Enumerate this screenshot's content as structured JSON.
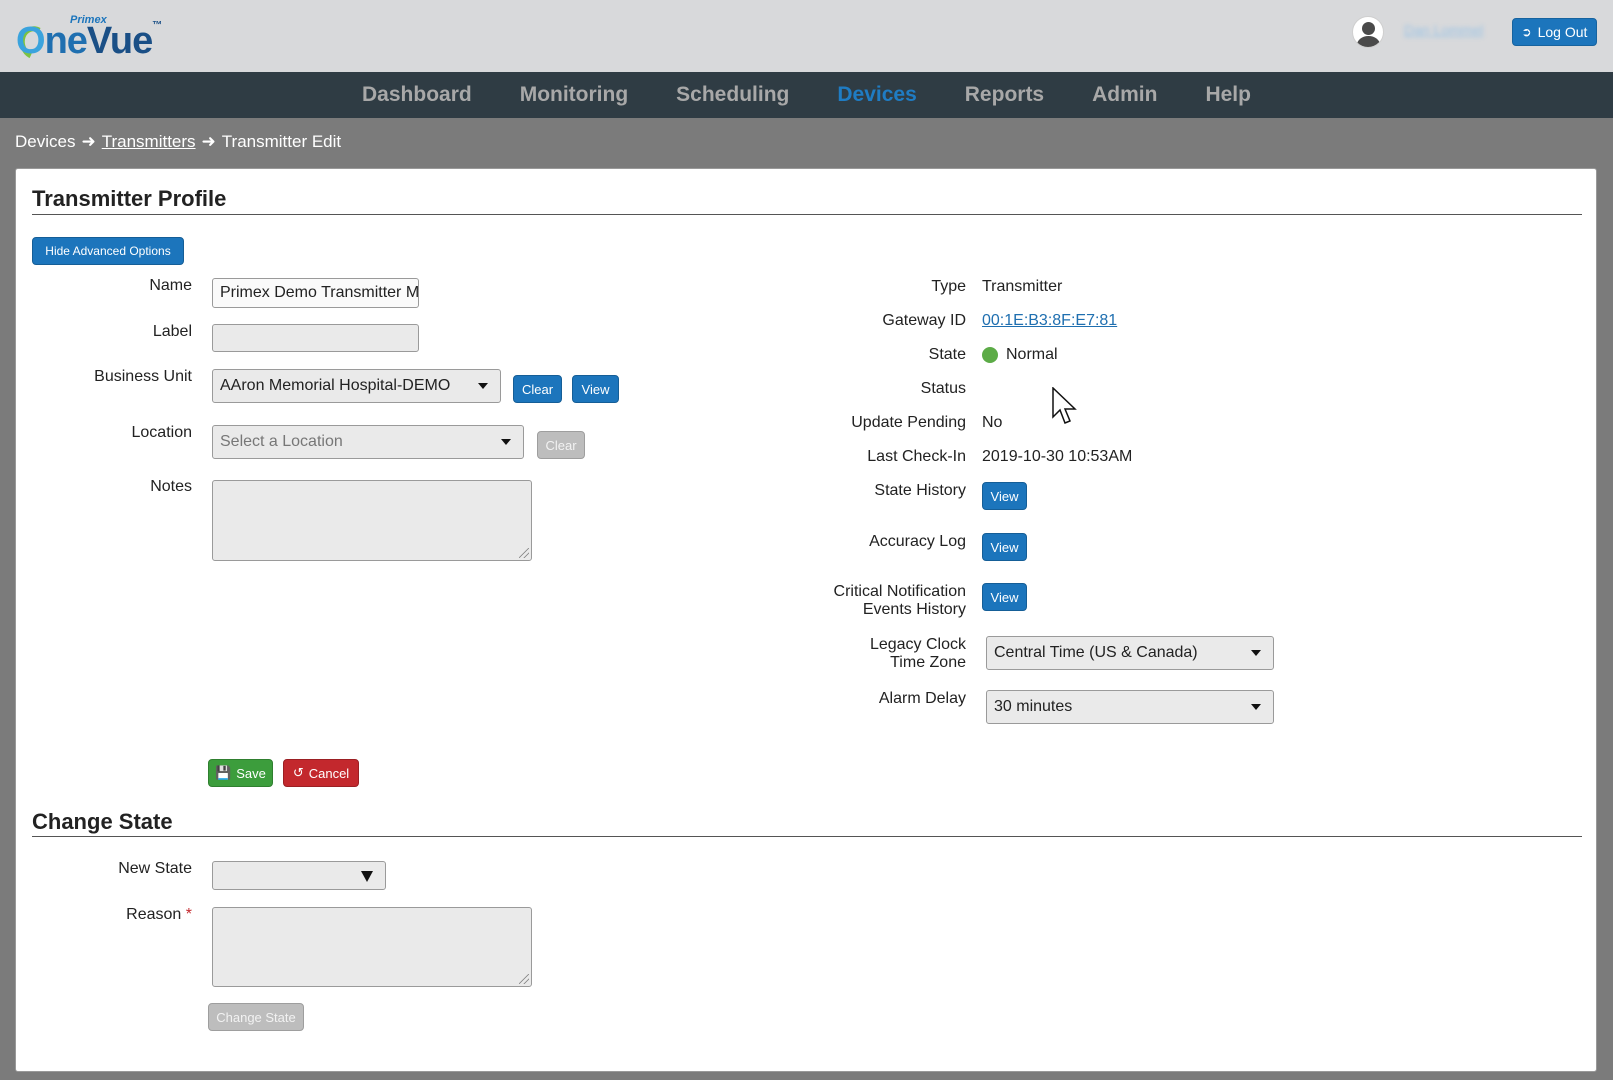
{
  "header": {
    "logo_brand": "Primex",
    "logo_o": "O",
    "logo_ne": "ne",
    "logo_vue": "Vue",
    "logo_tm": "™",
    "username": "Dan Lommel",
    "logout_label": "Log Out",
    "logout_icon": "sign-out-icon"
  },
  "nav": {
    "items": [
      "Dashboard",
      "Monitoring",
      "Scheduling",
      "Devices",
      "Reports",
      "Admin",
      "Help"
    ],
    "active": "Devices"
  },
  "breadcrumb": {
    "root": "Devices",
    "parent": "Transmitters",
    "current": "Transmitter Edit"
  },
  "profile": {
    "title": "Transmitter Profile",
    "advanced_toggle": "Hide Advanced Options",
    "name_label": "Name",
    "name_value": "Primex Demo Transmitter Main",
    "label_label": "Label",
    "label_value": "",
    "business_unit_label": "Business Unit",
    "business_unit_value": "AAron Memorial Hospital-DEMO",
    "bu_clear": "Clear",
    "bu_view": "View",
    "location_label": "Location",
    "location_placeholder": "Select a Location",
    "location_clear": "Clear",
    "notes_label": "Notes",
    "notes_value": "",
    "save_label": "Save",
    "cancel_label": "Cancel"
  },
  "details": {
    "type_label": "Type",
    "type_value": "Transmitter",
    "gateway_label": "Gateway ID",
    "gateway_value": "00:1E:B3:8F:E7:81",
    "state_label": "State",
    "state_value": "Normal",
    "state_color": "#5cab47",
    "status_label": "Status",
    "status_value": "",
    "update_pending_label": "Update Pending",
    "update_pending_value": "No",
    "last_checkin_label": "Last Check-In",
    "last_checkin_value": "2019-10-30 10:53AM",
    "state_history_label": "State History",
    "state_history_btn": "View",
    "accuracy_log_label": "Accuracy Log",
    "accuracy_log_btn": "View",
    "critical_label_1": "Critical Notification",
    "critical_label_2": "Events History",
    "critical_btn": "View",
    "legacy_label_1": "Legacy Clock",
    "legacy_label_2": "Time Zone",
    "legacy_value": "Central Time (US & Canada)",
    "alarm_delay_label": "Alarm Delay",
    "alarm_delay_value": "30 minutes"
  },
  "change_state": {
    "title": "Change State",
    "new_state_label": "New State",
    "new_state_value": "",
    "reason_label": "Reason",
    "reason_required": "*",
    "reason_value": "",
    "button_label": "Change State"
  }
}
